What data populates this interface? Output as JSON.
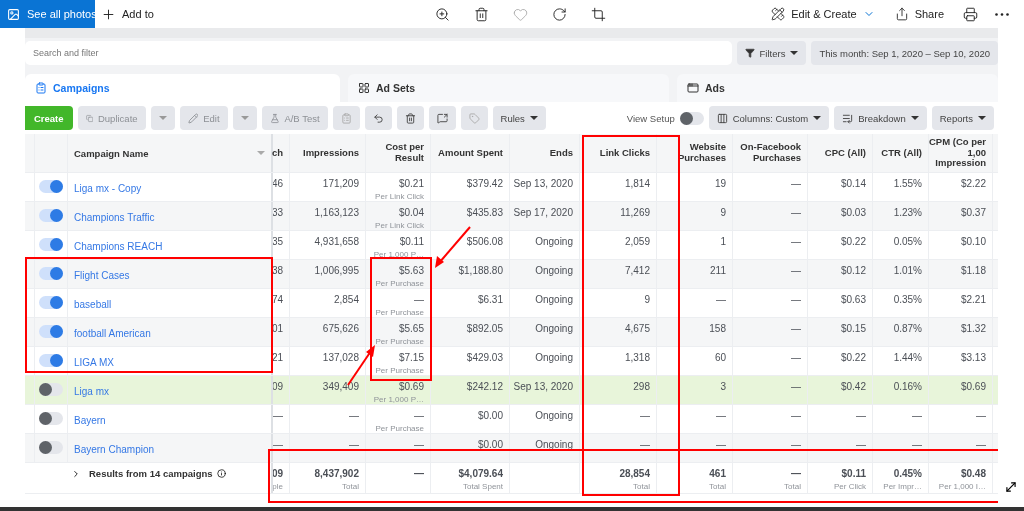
{
  "photos_toolbar": {
    "see_all": "See all photos",
    "add_to": "Add to",
    "edit_create": "Edit & Create",
    "share": "Share"
  },
  "ads_manager": {
    "search": {
      "placeholder": "Search and filter"
    },
    "filters": "Filters",
    "date_range": "This month: Sep 1, 2020 – Sep 10, 2020",
    "tabs": [
      {
        "label": "Campaigns",
        "selected": true
      },
      {
        "label": "Ad Sets",
        "selected": false
      },
      {
        "label": "Ads",
        "selected": false
      }
    ],
    "toolbar": {
      "create": "Create",
      "duplicate": {
        "label": "Duplicate",
        "disabled": true
      },
      "edit": {
        "label": "Edit",
        "disabled": true
      },
      "ab_test": {
        "label": "A/B Test",
        "disabled": true
      },
      "rules": "Rules",
      "view_setup": {
        "label": "View Setup",
        "on": false
      },
      "columns": "Columns: Custom",
      "breakdown": "Breakdown",
      "reports": "Reports"
    },
    "table": {
      "name_header": "Campaign Name",
      "columns": [
        "ch",
        "Impressions",
        "Cost per Result",
        "Amount Spent",
        "Ends",
        "Link Clicks",
        "Website Purchases",
        "On-Facebook Purchases",
        "CPC (All)",
        "CTR (All)",
        "CPM (Co per 1,00 Impression"
      ],
      "rows": [
        {
          "name": "Liga mx - Copy",
          "on": true,
          "highlighted": false,
          "cells": [
            {
              "v": "46"
            },
            {
              "v": "171,209"
            },
            {
              "v": "$0.21",
              "sub": "Per Link Click"
            },
            {
              "v": "$379.42"
            },
            {
              "v": "Sep 13, 2020"
            },
            {
              "v": "1,814"
            },
            {
              "v": "19"
            },
            {
              "v": "—"
            },
            {
              "v": "$0.14"
            },
            {
              "v": "1.55%"
            },
            {
              "v": "$2.22"
            }
          ]
        },
        {
          "name": "Champions Traffic",
          "on": true,
          "highlighted": false,
          "cells": [
            {
              "v": "33"
            },
            {
              "v": "1,163,123"
            },
            {
              "v": "$0.04",
              "sub": "Per Link Click"
            },
            {
              "v": "$435.83"
            },
            {
              "v": "Sep 17, 2020"
            },
            {
              "v": "11,269"
            },
            {
              "v": "9"
            },
            {
              "v": "—"
            },
            {
              "v": "$0.03"
            },
            {
              "v": "1.23%"
            },
            {
              "v": "$0.37"
            }
          ]
        },
        {
          "name": "Champions REACH",
          "on": true,
          "highlighted": false,
          "cells": [
            {
              "v": "35"
            },
            {
              "v": "4,931,658"
            },
            {
              "v": "$0.11",
              "sub": "Per 1,000 P…"
            },
            {
              "v": "$506.08"
            },
            {
              "v": "Ongoing"
            },
            {
              "v": "2,059"
            },
            {
              "v": "1"
            },
            {
              "v": "—"
            },
            {
              "v": "$0.22"
            },
            {
              "v": "0.05%"
            },
            {
              "v": "$0.10"
            }
          ]
        },
        {
          "name": "Flight Cases",
          "on": true,
          "highlighted": false,
          "cells": [
            {
              "v": "38"
            },
            {
              "v": "1,006,995"
            },
            {
              "v": "$5.63",
              "sub": "Per Purchase"
            },
            {
              "v": "$1,188.80"
            },
            {
              "v": "Ongoing"
            },
            {
              "v": "7,412"
            },
            {
              "v": "211"
            },
            {
              "v": "—"
            },
            {
              "v": "$0.12"
            },
            {
              "v": "1.01%"
            },
            {
              "v": "$1.18"
            }
          ]
        },
        {
          "name": "baseball",
          "on": true,
          "highlighted": false,
          "cells": [
            {
              "v": "74"
            },
            {
              "v": "2,854"
            },
            {
              "v": "—",
              "sub": "Per Purchase"
            },
            {
              "v": "$6.31"
            },
            {
              "v": "Ongoing"
            },
            {
              "v": "9"
            },
            {
              "v": "—"
            },
            {
              "v": "—"
            },
            {
              "v": "$0.63"
            },
            {
              "v": "0.35%"
            },
            {
              "v": "$2.21"
            }
          ]
        },
        {
          "name": "football American",
          "on": true,
          "highlighted": false,
          "cells": [
            {
              "v": "01"
            },
            {
              "v": "675,626"
            },
            {
              "v": "$5.65",
              "sub": "Per Purchase"
            },
            {
              "v": "$892.05"
            },
            {
              "v": "Ongoing"
            },
            {
              "v": "4,675"
            },
            {
              "v": "158"
            },
            {
              "v": "—"
            },
            {
              "v": "$0.15"
            },
            {
              "v": "0.87%"
            },
            {
              "v": "$1.32"
            }
          ]
        },
        {
          "name": "LIGA MX",
          "on": true,
          "highlighted": false,
          "cells": [
            {
              "v": "21"
            },
            {
              "v": "137,028"
            },
            {
              "v": "$7.15",
              "sub": "Per Purchase"
            },
            {
              "v": "$429.03"
            },
            {
              "v": "Ongoing"
            },
            {
              "v": "1,318"
            },
            {
              "v": "60"
            },
            {
              "v": "—"
            },
            {
              "v": "$0.22"
            },
            {
              "v": "1.44%"
            },
            {
              "v": "$3.13"
            }
          ]
        },
        {
          "name": "Liga mx",
          "on": false,
          "highlighted": true,
          "cells": [
            {
              "v": "09"
            },
            {
              "v": "349,409"
            },
            {
              "v": "$0.69",
              "sub": "Per 1,000 P…"
            },
            {
              "v": "$242.12"
            },
            {
              "v": "Sep 13, 2020"
            },
            {
              "v": "298"
            },
            {
              "v": "3"
            },
            {
              "v": "—"
            },
            {
              "v": "$0.42"
            },
            {
              "v": "0.16%"
            },
            {
              "v": "$0.69"
            }
          ]
        },
        {
          "name": "Bayern",
          "on": false,
          "highlighted": false,
          "cells": [
            {
              "v": "—"
            },
            {
              "v": "—"
            },
            {
              "v": "—",
              "sub": "Per Purchase"
            },
            {
              "v": "$0.00"
            },
            {
              "v": "Ongoing"
            },
            {
              "v": "—"
            },
            {
              "v": "—"
            },
            {
              "v": "—"
            },
            {
              "v": "—"
            },
            {
              "v": "—"
            },
            {
              "v": "—"
            }
          ]
        },
        {
          "name": "Bayern Champion",
          "on": false,
          "highlighted": false,
          "cells": [
            {
              "v": "—"
            },
            {
              "v": "—"
            },
            {
              "v": "—"
            },
            {
              "v": "$0.00"
            },
            {
              "v": "Ongoing"
            },
            {
              "v": "—"
            },
            {
              "v": "—"
            },
            {
              "v": "—"
            },
            {
              "v": "—"
            },
            {
              "v": "—"
            },
            {
              "v": "—"
            }
          ]
        }
      ],
      "footer": {
        "label": "Results from 14 campaigns",
        "cells": [
          {
            "v": "09",
            "sub": "ple"
          },
          {
            "v": "8,437,902",
            "sub": "Total"
          },
          {
            "v": "—"
          },
          {
            "v": "$4,079.64",
            "sub": "Total Spent"
          },
          null,
          {
            "v": "28,854",
            "sub": "Total"
          },
          {
            "v": "461",
            "sub": "Total"
          },
          {
            "v": "—",
            "sub": "Total"
          },
          {
            "v": "$0.11",
            "sub": "Per Click"
          },
          {
            "v": "0.45%",
            "sub": "Per Impr…"
          },
          {
            "v": "$0.48",
            "sub": "Per 1,000 I…"
          }
        ]
      }
    }
  }
}
